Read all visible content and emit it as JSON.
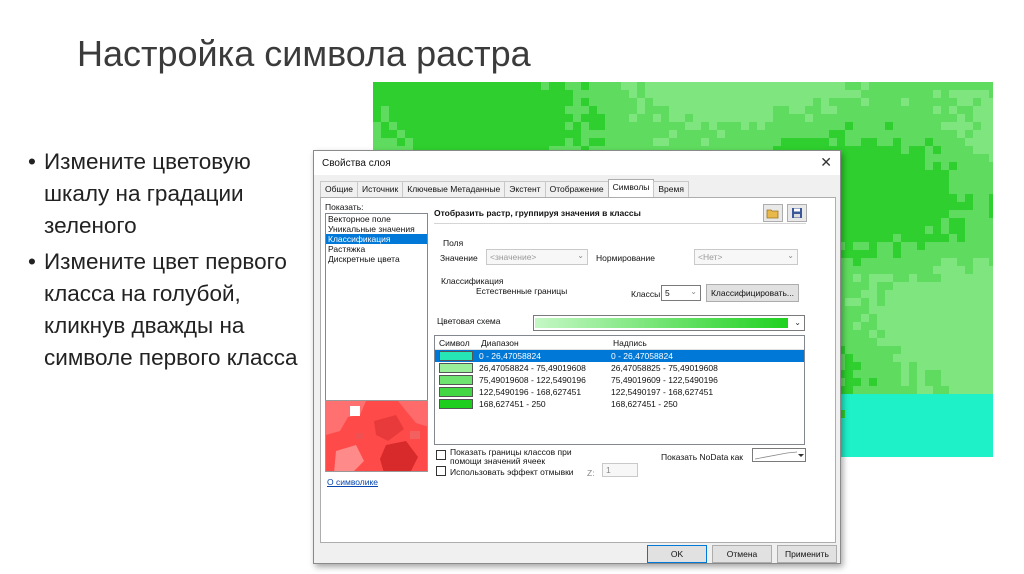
{
  "slide": {
    "title": "Настройка символа растра",
    "bullets": [
      "Измените цветовую шкалу на градации зеленого",
      "Измените цвет первого класса на голубой, кликнув дважды на символе первого класса"
    ]
  },
  "colors": {
    "raster_light": "#7fe57f",
    "raster_mid": "#5fdc5f",
    "raster_dark": "#2ecf2e",
    "raster_cyan": "#1ef0c8",
    "selection": "#0078d7"
  },
  "dialog": {
    "title": "Свойства слоя",
    "close_icon": "close-icon",
    "tabs": [
      "Общие",
      "Источник",
      "Ключевые Метаданные",
      "Экстент",
      "Отображение",
      "Символы",
      "Время"
    ],
    "active_tab": "Символы",
    "show": {
      "label": "Показать:",
      "items": [
        "Векторное поле",
        "Уникальные значения",
        "Классификация",
        "Растяжка",
        "Дискретные цвета"
      ],
      "selected": "Классификация"
    },
    "about_link": "О символике",
    "main_title": "Отобразить растр, группируя значения в классы",
    "field": {
      "group": "Поля",
      "value_label": "Значение",
      "value_select": "<значение>",
      "norm_label": "Нормирование",
      "norm_select": "<Нет>"
    },
    "classification": {
      "group": "Классификация",
      "method": "Естественные границы",
      "classes_label": "Классы",
      "classes_value": "5",
      "classify_button": "Классифицировать..."
    },
    "color_scheme_label": "Цветовая схема",
    "table": {
      "headers": [
        "Символ",
        "Диапазон",
        "Надпись"
      ],
      "rows": [
        {
          "range": "0 - 26,47058824",
          "label": "0 - 26,47058824",
          "color": "#25e6b4"
        },
        {
          "range": "26,47058824 - 75,49019608",
          "label": "26,47058825 - 75,49019608",
          "color": "#9af09a"
        },
        {
          "range": "75,49019608 - 122,5490196",
          "label": "75,49019609 - 122,5490196",
          "color": "#6fe36f"
        },
        {
          "range": "122,5490196 - 168,627451",
          "label": "122,5490197 - 168,627451",
          "color": "#43d843"
        },
        {
          "range": "168,627451 - 250",
          "label": "168,627451 - 250",
          "color": "#1ece1e"
        }
      ]
    },
    "show_borders": "Показать границы классов при помощи значений ячеек",
    "hillshade": "Использовать эффект отмывки",
    "z_label": "Z:",
    "z_value": "1",
    "nodata_label": "Показать NoData как",
    "buttons": {
      "ok": "OK",
      "cancel": "Отмена",
      "apply": "Применить"
    }
  }
}
